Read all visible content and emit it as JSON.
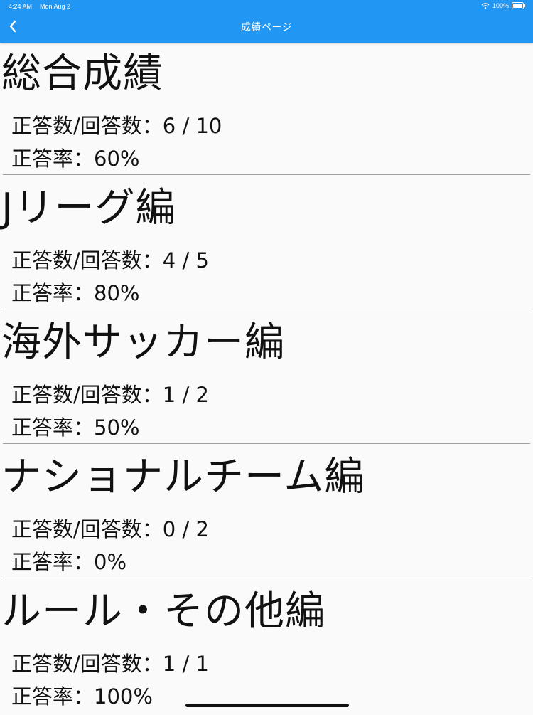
{
  "status_bar": {
    "time": "4:24 AM",
    "date": "Mon Aug 2",
    "battery": "100%"
  },
  "nav": {
    "title": "成績ページ",
    "back_icon": "chevron-left-icon"
  },
  "sections": [
    {
      "title": "総合成績",
      "count_label": "正答数/回答数：",
      "count_value": "6 / 10",
      "rate_label": "正答率：",
      "rate_value": "60%"
    },
    {
      "title": "Jリーグ編",
      "count_label": "正答数/回答数：",
      "count_value": "4 / 5",
      "rate_label": "正答率：",
      "rate_value": "80%"
    },
    {
      "title": "海外サッカー編",
      "count_label": "正答数/回答数：",
      "count_value": "1 / 2",
      "rate_label": "正答率：",
      "rate_value": "50%"
    },
    {
      "title": "ナショナルチーム編",
      "count_label": "正答数/回答数：",
      "count_value": "0 / 2",
      "rate_label": "正答率：",
      "rate_value": "0%"
    },
    {
      "title": "ルール・その他編",
      "count_label": "正答数/回答数：",
      "count_value": "1 / 1",
      "rate_label": "正答率：",
      "rate_value": "100%"
    }
  ],
  "colors": {
    "app_bar": "#2196f3",
    "background": "#fafafa",
    "divider": "#9e9e9e"
  }
}
